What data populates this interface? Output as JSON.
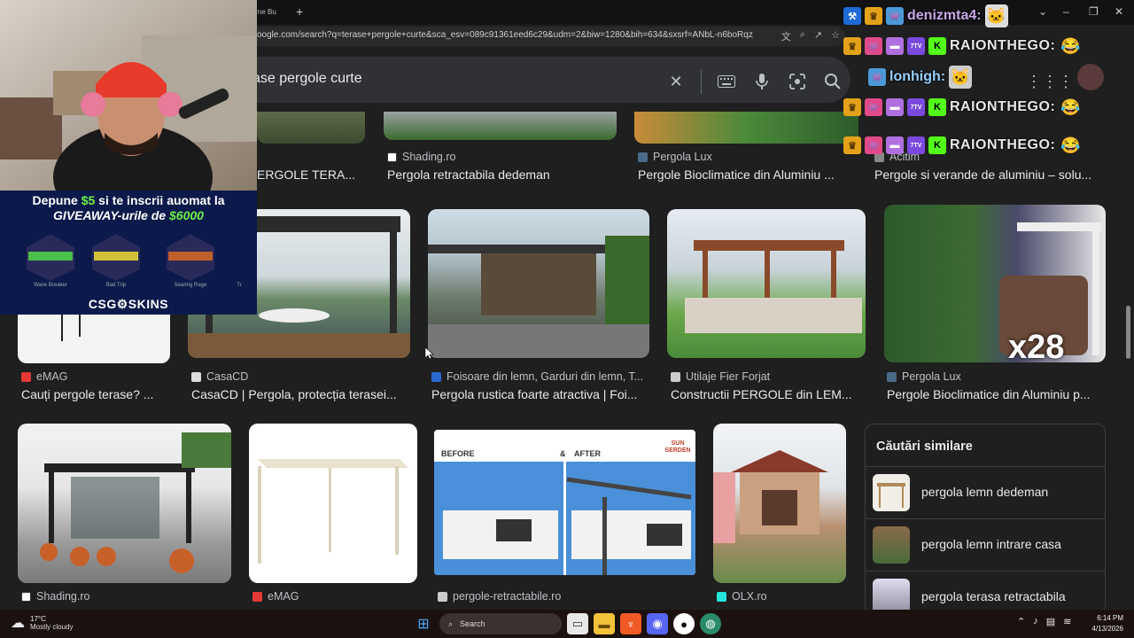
{
  "browser": {
    "tab_title": "lerne Bu",
    "new_tab_label": "+",
    "url": "oogle.com/search?q=terase+pergole+curte&sca_esv=089c91361eed6c29&udm=2&biw=1280&bih=634&sxsrf=ANbL-n6boRqzjNJdmz...",
    "window_controls": [
      "–",
      "❐",
      "✕"
    ],
    "tab_chevron": "⌄"
  },
  "search": {
    "query": "ase pergole curte"
  },
  "top_row": [
    {
      "source": "",
      "title": "ERGOLE TERA..."
    },
    {
      "source": "Shading.ro",
      "title": "Pergola retractabila dedeman"
    },
    {
      "source": "Pergola Lux",
      "title": "Pergole Bioclimatice din Aluminiu ..."
    },
    {
      "source": "Acitim",
      "title": "Pergole si verande de aluminiu – solu..."
    }
  ],
  "middle_row": [
    {
      "source": "eMAG",
      "title": "Cauți pergole terase? ..."
    },
    {
      "source": "CasaCD",
      "title": "CasaCD | Pergola, protecția terasei..."
    },
    {
      "source": "Foisoare din lemn, Garduri din lemn, T...",
      "title": "Pergola rustica foarte atractiva | Foi..."
    },
    {
      "source": "Utilaje Fier Forjat",
      "title": "Constructii PERGOLE din LEM..."
    },
    {
      "source": "Pergola Lux",
      "title": "Pergole Bioclimatice din Aluminiu p..."
    }
  ],
  "bottom_row": [
    {
      "source": "Shading.ro"
    },
    {
      "source": "eMAG"
    },
    {
      "source": "pergole-retractabile.ro",
      "before": "BEFORE",
      "amp": "&",
      "after": "AFTER",
      "logo": "SUN SERDEN"
    },
    {
      "source": "OLX.ro"
    }
  ],
  "overlay_emote_text": "x28",
  "similar": {
    "title": "Căutări similare",
    "items": [
      {
        "label": "pergola lemn dedeman"
      },
      {
        "label": "pergola lemn intrare casa"
      },
      {
        "label": "pergola terasa retractabila"
      }
    ]
  },
  "promo": {
    "line1_a": "Depune ",
    "line1_amount": "$5",
    "line1_b": " si te inscrii auomat la",
    "line2_a": "GIVEAWAY-urile de ",
    "line2_amount": "$6000",
    "skins": [
      "Wave Breaker",
      "Bad Trip",
      "Searing Rage",
      "Tr"
    ],
    "brand": "CSG⚙SKINS"
  },
  "chat": [
    {
      "user": "denizmta4:",
      "badges": [
        "⚒",
        "♛",
        "👾"
      ]
    },
    {
      "user": "RAIONTHEGO:",
      "badges": [
        "♛",
        "👾",
        "▬",
        "7TV",
        "K"
      ]
    },
    {
      "user": "lonhigh:",
      "badges": [
        "👾"
      ]
    },
    {
      "user": "RAIONTHEGO:",
      "badges": [
        "♛",
        "👾",
        "▬",
        "7TV",
        "K"
      ]
    },
    {
      "user": "RAIONTHEGO:",
      "badges": [
        "♛",
        "👾",
        "▬",
        "7TV",
        "K"
      ]
    }
  ],
  "taskbar": {
    "temp": "17°C",
    "weather": "Mostly cloudy",
    "search_label": "Search",
    "time": "6:14 PM",
    "date": "4/13/2026"
  },
  "colors": {
    "page_bg": "#1f1f1f",
    "search_bg": "#303134",
    "text": "#e8eaed",
    "muted": "#bdc1c6",
    "promo_bg": "#0b1a4a",
    "promo_green": "#6cf04a"
  }
}
